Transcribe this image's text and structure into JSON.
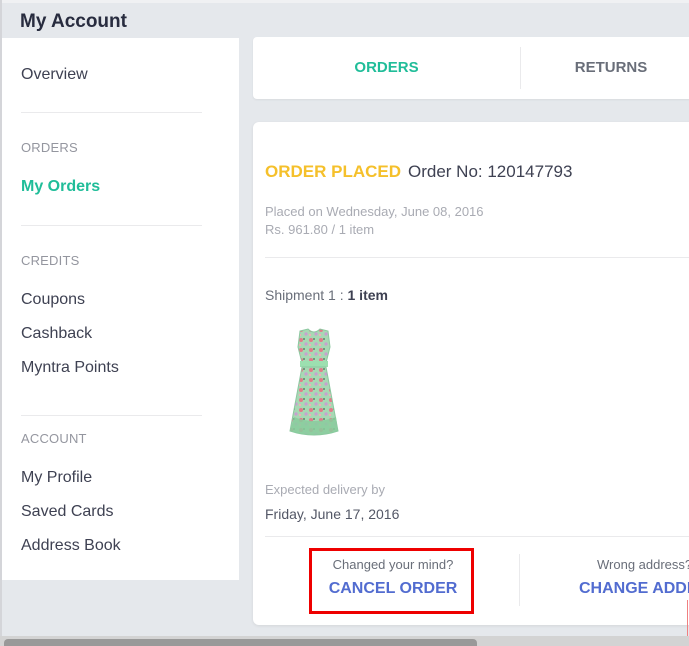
{
  "page": {
    "title": "My Account"
  },
  "sidebar": {
    "overview": "Overview",
    "sections": [
      {
        "heading": "ORDERS",
        "items": [
          {
            "label": "My Orders",
            "active": true
          }
        ]
      },
      {
        "heading": "CREDITS",
        "items": [
          {
            "label": "Coupons"
          },
          {
            "label": "Cashback"
          },
          {
            "label": "Myntra Points"
          }
        ]
      },
      {
        "heading": "ACCOUNT",
        "items": [
          {
            "label": "My Profile"
          },
          {
            "label": "Saved Cards"
          },
          {
            "label": "Address Book"
          }
        ]
      }
    ]
  },
  "tabs": [
    {
      "label": "ORDERS",
      "active": true
    },
    {
      "label": "RETURNS",
      "active": false
    }
  ],
  "order": {
    "status": "ORDER PLACED",
    "order_no": "Order No: 120147793",
    "placed_on": "Placed on Wednesday, June 08, 2016",
    "price_summary": "Rs. 961.80 / 1 item",
    "shipment_label": "Shipment 1 : ",
    "shipment_count": "1 item",
    "product_image": "green-floral-dress",
    "expected_delivery_label": "Expected delivery by",
    "expected_delivery_date": "Friday, June 17, 2016",
    "actions": [
      {
        "question": "Changed your mind?",
        "button": "CANCEL ORDER"
      },
      {
        "question": "Wrong address?",
        "button": "CHANGE ADDRESS"
      }
    ]
  },
  "colors": {
    "accent_green": "#20bd99",
    "status_yellow": "#f5c02b",
    "action_blue": "#526cd0",
    "highlight_red": "#ee0000"
  }
}
